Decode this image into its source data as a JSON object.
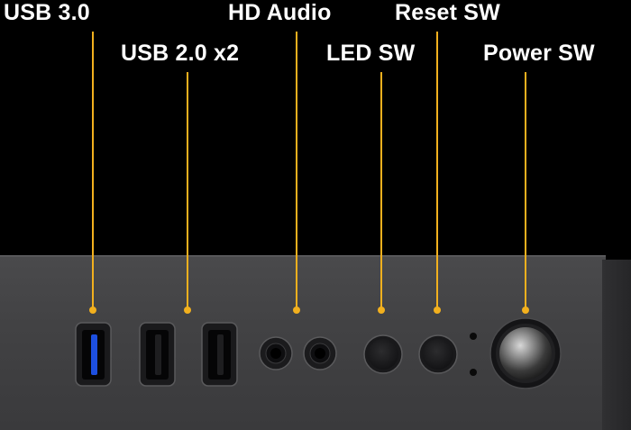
{
  "labels": {
    "usb3": "USB 3.0",
    "usb2": "USB 2.0 x2",
    "hd_audio": "HD Audio",
    "led_sw": "LED SW",
    "reset_sw": "Reset SW",
    "power_sw": "Power SW"
  },
  "colors": {
    "leader_line": "#f2b01e",
    "background": "#000000",
    "panel": "#434345",
    "usb3_port": "#1d4fe0"
  }
}
